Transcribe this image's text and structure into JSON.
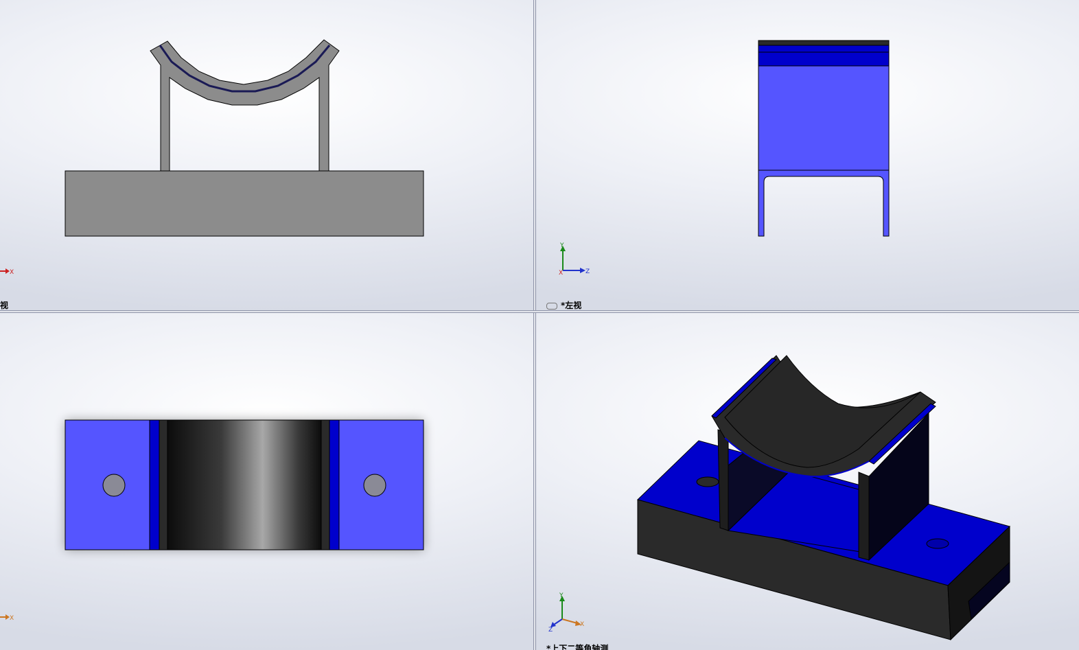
{
  "viewports": {
    "front": {
      "label": "视",
      "triad": [
        "X"
      ]
    },
    "left": {
      "label": "*左视",
      "triad": [
        "Y",
        "Z",
        "X"
      ]
    },
    "top": {
      "label": "",
      "triad": [
        "X"
      ]
    },
    "iso": {
      "label": "*上下二等角轴测",
      "triad": [
        "Y",
        "X",
        "Z"
      ]
    }
  },
  "colors": {
    "part_gray": "#8c8c8c",
    "face_blue": "#5555ff",
    "dark_blue": "#0000cc",
    "dark_face": "#2a2a2a",
    "edge": "#000000"
  }
}
